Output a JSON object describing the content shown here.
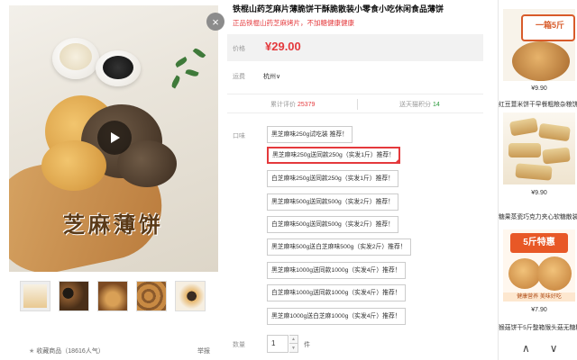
{
  "gallery": {
    "image_caption": "芝麻薄饼",
    "close_glyph": "×",
    "favorite_label": "收藏商品",
    "favorite_count": "（18616人气）",
    "report_label": "举报",
    "thumbnail_count": 5
  },
  "product": {
    "title": "铁棍山药芝麻片薄脆饼干酥脆散装小零食小吃休闲食品薄饼",
    "subtitle": "正品铁棍山药芝麻烤片，不加糖健康健康",
    "price_label": "价格",
    "price": "¥29.00",
    "shipping_label": "运费",
    "shipping_region": "杭州∨",
    "reviews_label": "累计评价",
    "reviews_count": "25379",
    "points_label": "送天猫积分",
    "points_value": "14",
    "flavor_label": "口味",
    "quantity_label": "数量",
    "quantity_value": "1",
    "quantity_unit": "件",
    "options": [
      {
        "label": "黑芝麻味250g试吃装 推荐！",
        "selected": false
      },
      {
        "label": "黑芝麻味250g送同款250g（实发1斤）推荐！",
        "selected": true
      },
      {
        "label": "白芝麻味250g送同款250g（实发1斤）推荐！",
        "selected": false
      },
      {
        "label": "黑芝麻味500g送同款500g（实发2斤）推荐！",
        "selected": false
      },
      {
        "label": "白芝麻味500g送同款500g（实发2斤）推荐！",
        "selected": false
      },
      {
        "label": "黑芝麻味500g送白芝麻味500g（实发2斤）推荐！",
        "selected": false
      },
      {
        "label": "黑芝麻味1000g送同款1000g（实发4斤）推荐！",
        "selected": false
      },
      {
        "label": "白芝麻味1000g送同款1000g（实发4斤）推荐！",
        "selected": false
      },
      {
        "label": "黑芝麻1000g送白芝麻1000g（实发4斤）推荐！",
        "selected": false
      }
    ]
  },
  "recommendations": [
    {
      "banner": "一箱5斤",
      "price": "¥9.90",
      "name": "红豆薏米饼干早餐粗粮杂粮饼"
    },
    {
      "banner": "",
      "price": "¥9.90",
      "name": "糖果蒸瓷巧克力夹心软糖散装小零"
    },
    {
      "banner": "5斤特惠",
      "tag": "健康营养 美味好吃",
      "price": "¥7.90",
      "name": "猴菇饼干5斤整箱猴头菇无糖精"
    }
  ],
  "rail_nav": {
    "up": "∧",
    "down": "∨"
  },
  "colors": {
    "accent_red": "#e4393c",
    "points_green": "#2a9a3c",
    "price_bg": "#f2f2f2"
  }
}
